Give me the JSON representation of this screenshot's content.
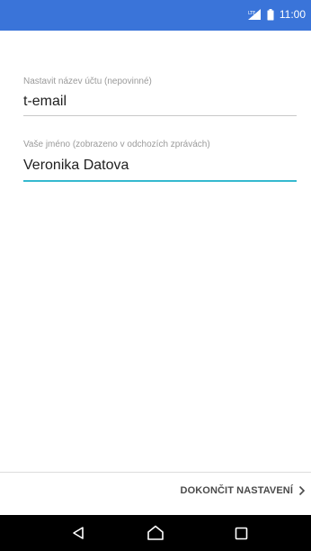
{
  "status_bar": {
    "time": "11:00",
    "network_type": "LTE"
  },
  "form": {
    "account_name": {
      "label": "Nastavit název účtu (nepovinné)",
      "value": "t-email"
    },
    "your_name": {
      "label": "Vaše jméno (zobrazeno v odchozích zprávách)",
      "value": "Veronika Datova"
    }
  },
  "footer": {
    "finish_label": "DOKONČIT NASTAVENÍ"
  },
  "icons": {
    "signal": "signal-icon",
    "battery": "battery-icon",
    "chevron": "chevron-right-icon",
    "back": "back-icon",
    "home": "home-icon",
    "recents": "recents-icon"
  },
  "colors": {
    "status_bar_bg": "#3a74d9",
    "active_underline": "#35b9cf",
    "nav_bar_bg": "#000000"
  }
}
